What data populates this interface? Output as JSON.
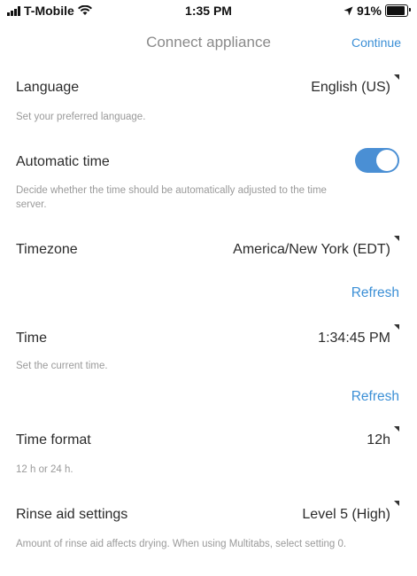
{
  "status_bar": {
    "carrier": "T-Mobile",
    "time": "1:35 PM",
    "battery": "91%",
    "battery_level": 0.91,
    "icons": [
      "signal-bars-icon",
      "wifi-icon",
      "location-arrow-icon",
      "battery-icon"
    ]
  },
  "nav": {
    "title": "Connect appliance",
    "continue_label": "Continue"
  },
  "settings": {
    "language": {
      "title": "Language",
      "value": "English (US)",
      "description": "Set your preferred language."
    },
    "automatic_time": {
      "title": "Automatic time",
      "enabled": true,
      "description": "Decide whether the time should be automatically adjusted to the time server."
    },
    "timezone": {
      "title": "Timezone",
      "value": "America/New York (EDT)",
      "refresh_label": "Refresh"
    },
    "time": {
      "title": "Time",
      "value": "1:34:45 PM",
      "description": "Set the current time.",
      "refresh_label": "Refresh"
    },
    "time_format": {
      "title": "Time format",
      "value": "12h",
      "description": "12 h or 24 h."
    },
    "rinse_aid": {
      "title": "Rinse aid settings",
      "value": "Level 5 (High)",
      "description": "Amount of rinse aid affects drying. When using Multitabs, select setting 0."
    }
  },
  "colors": {
    "accent": "#3b8fd6",
    "toggle_on": "#4a8fd4",
    "secondary_text": "#9a9a9a"
  }
}
